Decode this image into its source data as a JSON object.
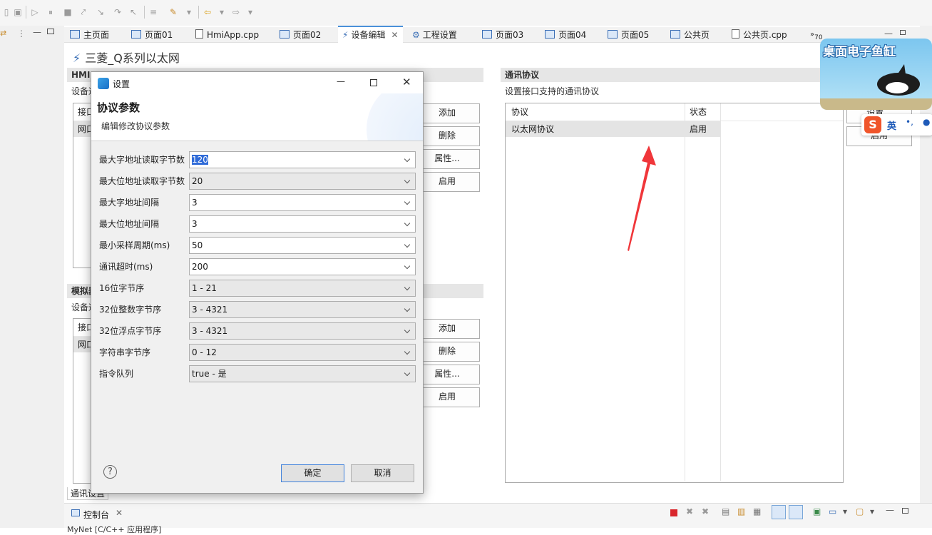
{
  "editor": {
    "title": "三菱_Q系列以太网",
    "tabs": [
      {
        "label": "主页面"
      },
      {
        "label": "页面01"
      },
      {
        "label": "HmiApp.cpp"
      },
      {
        "label": "页面02"
      },
      {
        "label": "设备编辑"
      },
      {
        "label": "工程设置"
      },
      {
        "label": "页面03"
      },
      {
        "label": "页面04"
      },
      {
        "label": "页面05"
      },
      {
        "label": "公共页"
      },
      {
        "label": "公共页.cpp"
      },
      {
        "label": "70"
      }
    ]
  },
  "hmi_section": {
    "header": "HMI",
    "desc": "设备通",
    "col": "接口",
    "row": "网口",
    "buttons": [
      "添加",
      "删除",
      "属性...",
      "启用"
    ]
  },
  "sim_section": {
    "header": "模拟器",
    "desc": "设备通",
    "col": "接口",
    "row": "网口",
    "buttons": [
      "添加",
      "删除",
      "属性...",
      "启用"
    ]
  },
  "protocol_section": {
    "header": "通讯协议",
    "desc": "设置接口支持的通讯协议",
    "columns": [
      "协议",
      "状态"
    ],
    "rows": [
      {
        "protocol": "以太网协议",
        "status": "启用"
      }
    ],
    "buttons": [
      "设置...",
      "启用"
    ]
  },
  "bottom_tab": "通讯设置",
  "console": {
    "label": "控制台",
    "line": "MyNet [C/C++ 应用程序]"
  },
  "overlay": {
    "banner_text": "桌面电子鱼缸",
    "ime_text": "英"
  },
  "dialog": {
    "title": "设置",
    "heading": "协议参数",
    "subheading": "编辑修改协议参数",
    "fields": [
      {
        "label": "最大字地址读取字节数",
        "value": "120",
        "highlight": true,
        "readonly": false
      },
      {
        "label": "最大位地址读取字节数",
        "value": "20",
        "readonly": true
      },
      {
        "label": "最大字地址间隔",
        "value": "3",
        "readonly": false
      },
      {
        "label": "最大位地址间隔",
        "value": "3",
        "readonly": false
      },
      {
        "label": "最小采样周期(ms)",
        "value": "50",
        "readonly": false
      },
      {
        "label": "通讯超时(ms)",
        "value": "200",
        "readonly": false
      },
      {
        "label": "16位字节序",
        "value": "1 - 21",
        "readonly": true
      },
      {
        "label": "32位整数字节序",
        "value": "3 - 4321",
        "readonly": true
      },
      {
        "label": "32位浮点字节序",
        "value": "3 - 4321",
        "readonly": true
      },
      {
        "label": "字符串字节序",
        "value": "0 - 12",
        "readonly": true
      },
      {
        "label": "指令队列",
        "value": "true - 是",
        "readonly": true
      }
    ],
    "ok_label": "确定",
    "cancel_label": "取消",
    "help_symbol": "?"
  },
  "colors": {
    "accent": "#3c7fdb",
    "arrow": "#f0363a",
    "selection": "#2f6bd8"
  }
}
